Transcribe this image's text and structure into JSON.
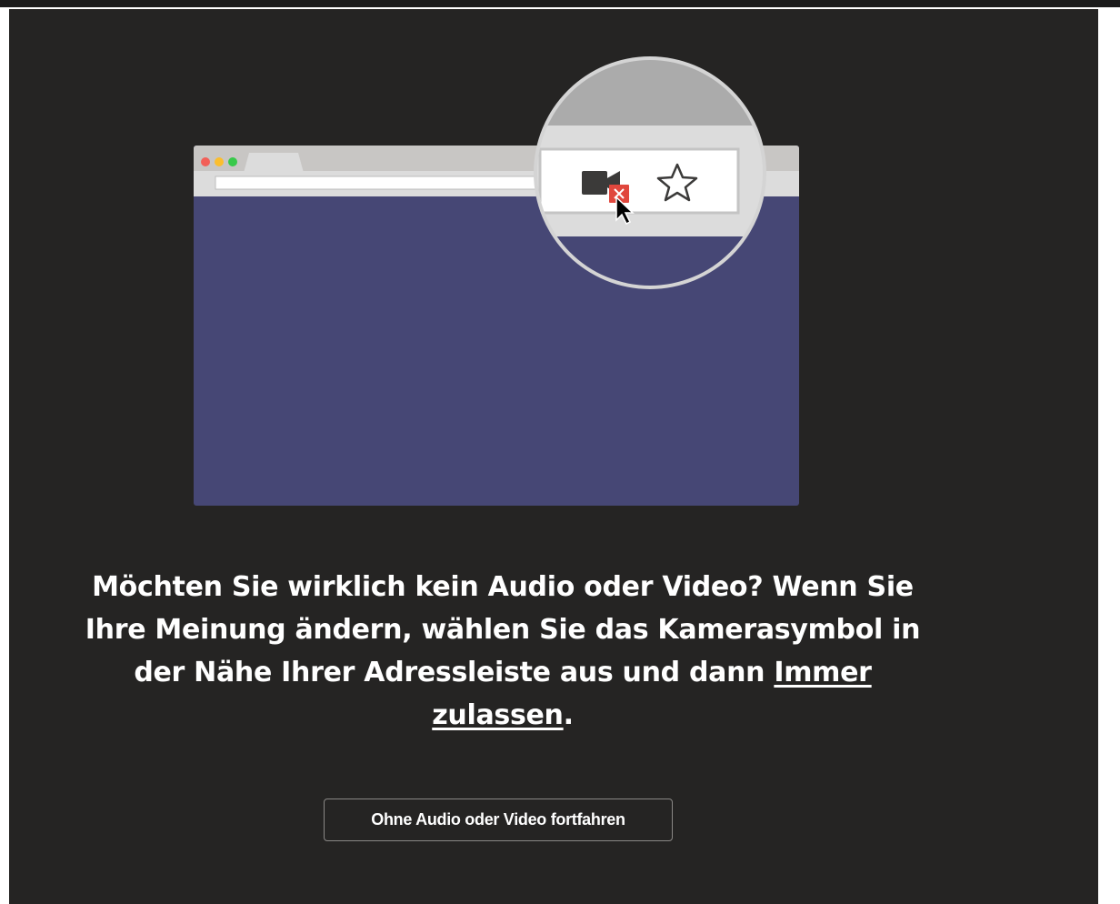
{
  "message": {
    "text": "Möchten Sie wirklich kein Audio oder Video? Wenn Sie Ihre Meinung ändern, wählen Sie das Kamerasymbol in der Nähe Ihrer Adressleiste aus und dann ",
    "link_label": "Immer zulassen",
    "suffix": "."
  },
  "continue_button": {
    "label": "Ohne Audio oder Video fortfahren"
  },
  "colors": {
    "background": "#252423",
    "browser_body": "#464775",
    "blocked_badge": "#e0473d"
  },
  "illustration": {
    "icons": [
      "camera-icon",
      "blocked-x-icon",
      "cursor-icon",
      "star-icon"
    ]
  }
}
